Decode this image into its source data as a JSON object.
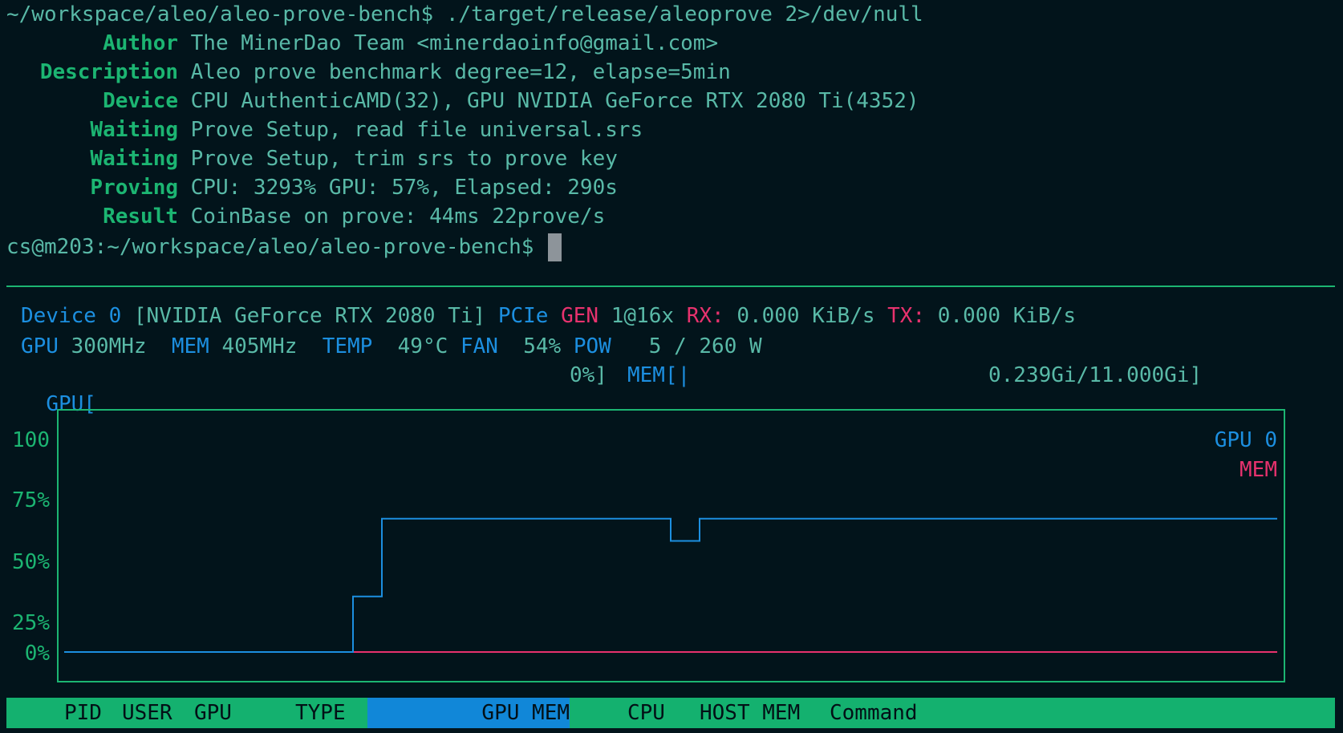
{
  "terminal": {
    "command_line": "~/workspace/aleo/aleo-prove-bench$ ./target/release/aleoprove 2>/dev/null",
    "rows": [
      {
        "label": "Author",
        "value": "The MinerDao Team <minerdaoinfo@gmail.com>"
      },
      {
        "label": "Description",
        "value": "Aleo prove benchmark degree=12, elapse=5min"
      },
      {
        "label": "Device",
        "value": "CPU AuthenticAMD(32), GPU NVIDIA GeForce RTX 2080 Ti(4352)"
      },
      {
        "label": "Waiting",
        "value": "Prove Setup, read file universal.srs"
      },
      {
        "label": "Waiting",
        "value": "Prove Setup, trim srs to prove key"
      },
      {
        "label": "Proving",
        "value": "CPU: 3293% GPU: 57%, Elapsed: 290s"
      },
      {
        "label": "Result",
        "value": "CoinBase on prove: 44ms 22prove/s"
      }
    ],
    "prompt": "cs@m203:~/workspace/aleo/aleo-prove-bench$ "
  },
  "nvtop": {
    "device_line": {
      "device": "Device 0",
      "name": "[NVIDIA GeForce RTX 2080 Ti]",
      "pcie_label": "PCIe",
      "gen_label": "GEN",
      "gen_value": "1@16x",
      "rx_label": "RX:",
      "rx_value": "0.000 KiB/s",
      "tx_label": "TX:",
      "tx_value": "0.000 KiB/s"
    },
    "clock_line": {
      "gpu_label": "GPU",
      "gpu_value": "300MHz",
      "mem_label": "MEM",
      "mem_value": "405MHz",
      "temp_label": "TEMP",
      "temp_value": "49°C",
      "fan_label": "FAN",
      "fan_value": "54%",
      "pow_label": "POW",
      "pow_value": "5 / 260 W"
    },
    "bars_line": {
      "gpu_label": "GPU[",
      "gpu_value": "0%]",
      "mem_label": "MEM[|",
      "mem_value": "0.239Gi/11.000Gi]"
    },
    "footer": {
      "pid": "PID",
      "user": "USER",
      "gpu": "GPU",
      "type": "TYPE",
      "gpu_mem": "GPU MEM",
      "cpu": "CPU",
      "host_mem": "HOST MEM",
      "command": "Command"
    }
  },
  "colors": {
    "background": "#02141b",
    "green": "#1cb572",
    "blue": "#1c8fe0",
    "pink": "#e8326e"
  },
  "chart_data": {
    "type": "line",
    "title": "",
    "ylabels": [
      "100",
      "75%",
      "50%",
      "25%",
      "0%"
    ],
    "ylim": [
      0,
      100
    ],
    "legend": [
      "GPU 0",
      "MEM"
    ],
    "legend_position": "top-right",
    "x": [
      0,
      1,
      2,
      3,
      4,
      5,
      6,
      7,
      8,
      9,
      10,
      11,
      12,
      13,
      14,
      15,
      16,
      17,
      18,
      19,
      20,
      21,
      22,
      23,
      24,
      25,
      26,
      27,
      28,
      29,
      30,
      31,
      32,
      33,
      34,
      35,
      36,
      37,
      38,
      39,
      40,
      41
    ],
    "series": [
      {
        "name": "GPU 0",
        "color": "#1c8fe0",
        "values": [
          0,
          0,
          0,
          0,
          0,
          0,
          0,
          0,
          0,
          0,
          25,
          60,
          60,
          60,
          60,
          60,
          60,
          60,
          60,
          60,
          60,
          50,
          60,
          60,
          60,
          60,
          60,
          60,
          60,
          60,
          60,
          60,
          60,
          60,
          60,
          60,
          60,
          60,
          60,
          60,
          60,
          60
        ]
      },
      {
        "name": "MEM",
        "color": "#e8326e",
        "values": [
          0,
          0,
          0,
          0,
          0,
          0,
          0,
          0,
          0,
          0,
          0,
          0,
          0,
          0,
          0,
          0,
          0,
          0,
          0,
          0,
          0,
          0,
          0,
          0,
          0,
          0,
          0,
          0,
          0,
          0,
          0,
          0,
          0,
          0,
          0,
          0,
          0,
          0,
          0,
          0,
          0,
          0
        ]
      }
    ]
  }
}
